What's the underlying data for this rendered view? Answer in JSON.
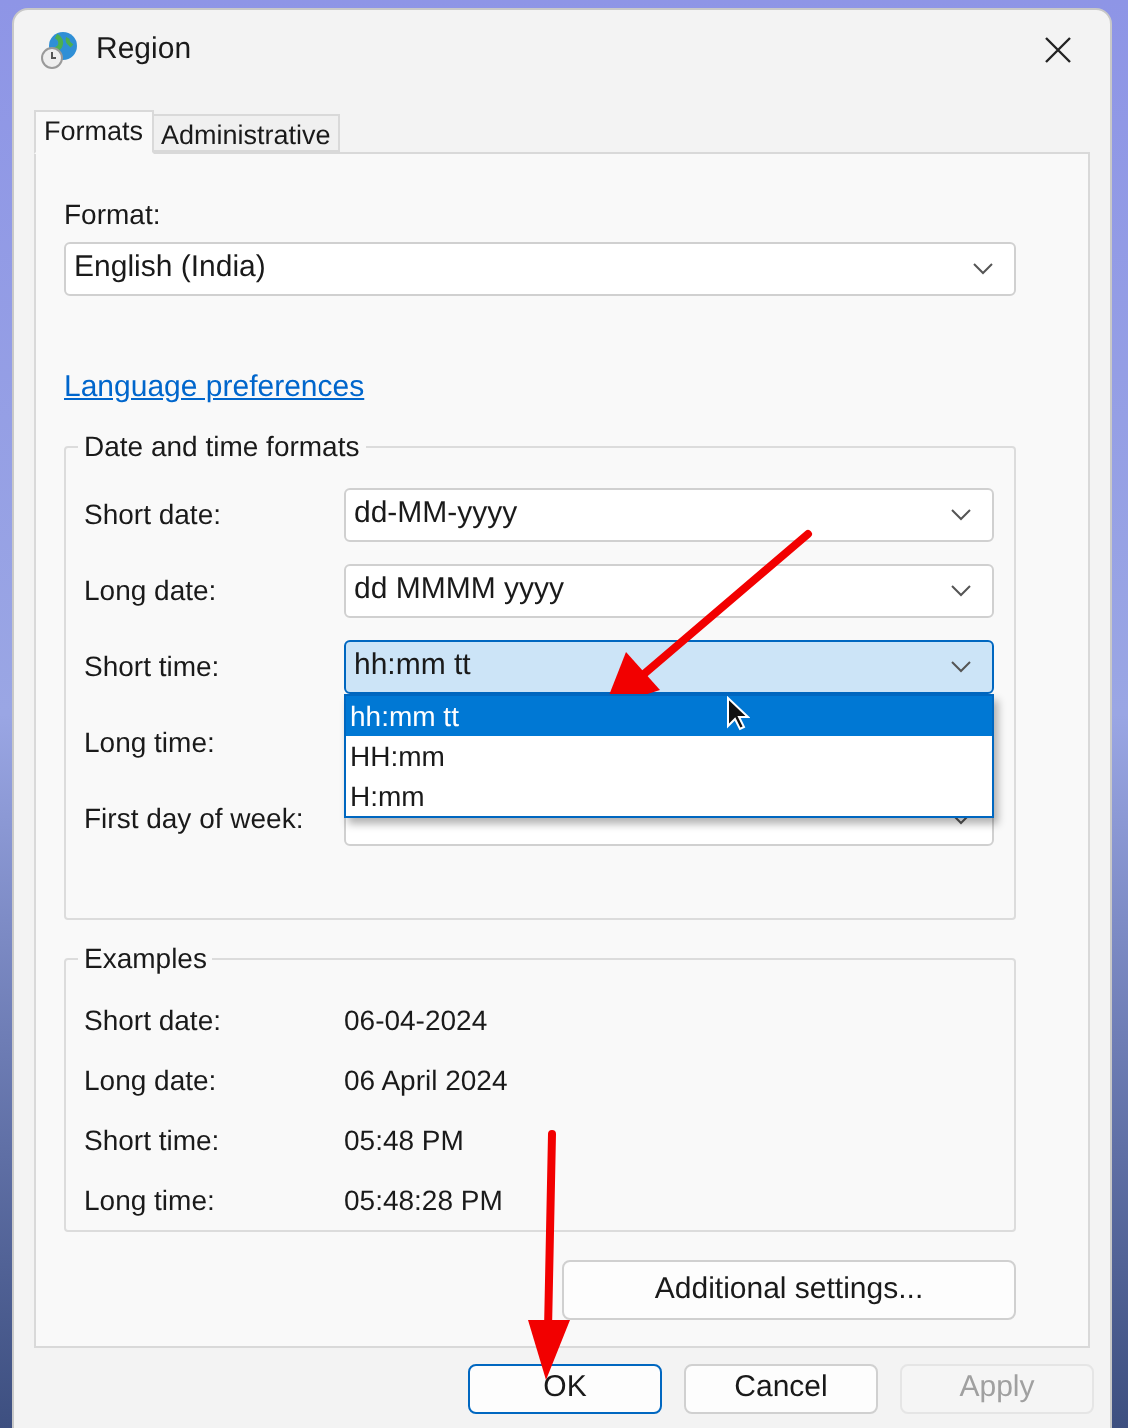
{
  "window": {
    "title": "Region"
  },
  "tabs": [
    {
      "label": "Formats",
      "selected": true
    },
    {
      "label": "Administrative",
      "selected": false
    }
  ],
  "format": {
    "label": "Format:",
    "value": "English (India)"
  },
  "link": "Language preferences",
  "date_time_formats": {
    "title": "Date and time formats",
    "rows": [
      {
        "label": "Short date:",
        "value": "dd-MM-yyyy",
        "expanded": false
      },
      {
        "label": "Long date:",
        "value": "dd MMMM yyyy",
        "expanded": false
      },
      {
        "label": "Short time:",
        "value": "hh:mm tt",
        "expanded": true,
        "options": [
          {
            "label": "hh:mm tt",
            "selected": true
          },
          {
            "label": "HH:mm",
            "selected": false
          },
          {
            "label": "H:mm",
            "selected": false
          }
        ]
      },
      {
        "label": "Long time:"
      },
      {
        "label": "First day of week:",
        "expanded": false
      }
    ]
  },
  "examples": {
    "title": "Examples",
    "rows": [
      {
        "label": "Short date:",
        "value": "06-04-2024"
      },
      {
        "label": "Long date:",
        "value": "06 April 2024"
      },
      {
        "label": "Short time:",
        "value": "05:48 PM"
      },
      {
        "label": "Long time:",
        "value": "05:48:28 PM"
      }
    ]
  },
  "additional_settings": "Additional settings...",
  "buttons": [
    {
      "label": "OK",
      "default": true,
      "disabled": false
    },
    {
      "label": "Cancel",
      "default": false,
      "disabled": false
    },
    {
      "label": "Apply",
      "default": false,
      "disabled": true
    }
  ]
}
